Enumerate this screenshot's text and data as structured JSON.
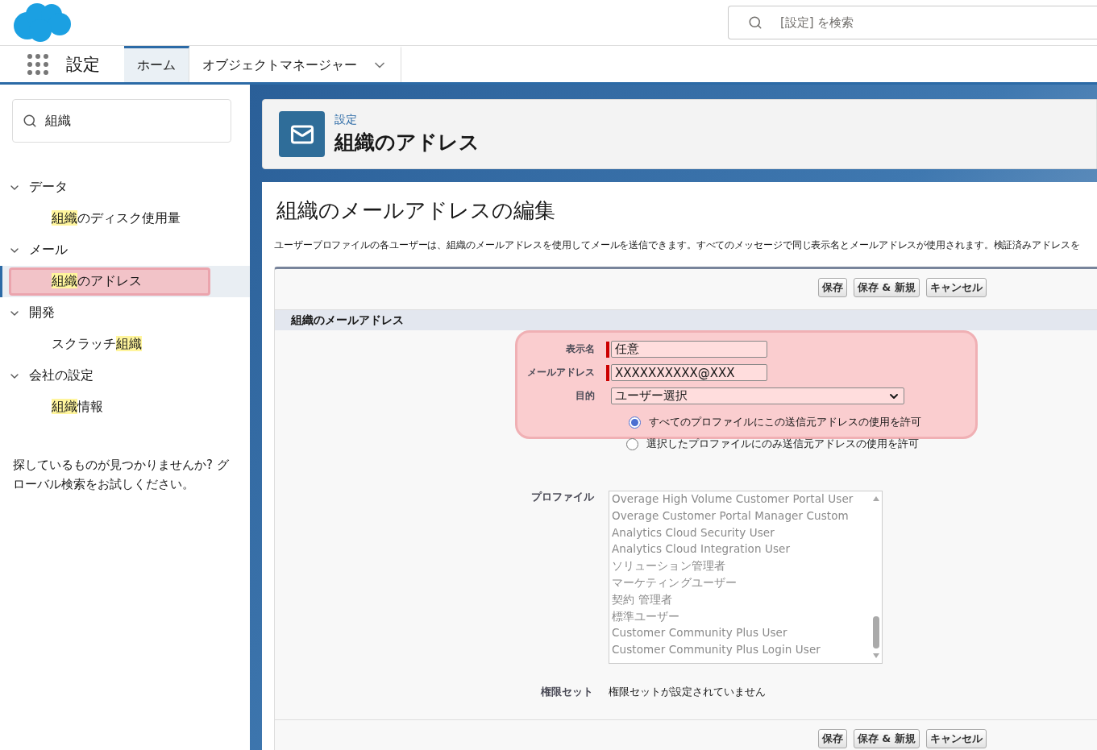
{
  "header": {
    "search": {
      "placeholder": "[設定] を検索"
    }
  },
  "nav": {
    "app_name": "設定",
    "tabs": [
      {
        "label": "ホーム",
        "selected": true,
        "dropdown": false
      },
      {
        "label": "オブジェクトマネージャー",
        "selected": false,
        "dropdown": true
      }
    ]
  },
  "sidebar": {
    "search": {
      "value": "組織"
    },
    "groups": [
      {
        "label": "データ",
        "expanded": true,
        "children": [
          {
            "parts": [
              {
                "text": "組織",
                "match": true
              },
              {
                "text": "のディスク使用量",
                "match": false
              }
            ],
            "selected": false,
            "highlighted": false
          }
        ]
      },
      {
        "label": "メール",
        "expanded": true,
        "children": [
          {
            "parts": [
              {
                "text": "組織",
                "match": true
              },
              {
                "text": "のアドレス",
                "match": false
              }
            ],
            "selected": true,
            "highlighted": true
          }
        ]
      },
      {
        "label": "開発",
        "expanded": true,
        "children": [
          {
            "parts": [
              {
                "text": "スクラッチ",
                "match": false
              },
              {
                "text": "組織",
                "match": true
              }
            ],
            "selected": false,
            "highlighted": false
          }
        ]
      },
      {
        "label": "会社の設定",
        "expanded": true,
        "children": [
          {
            "parts": [
              {
                "text": "組織",
                "match": true
              },
              {
                "text": "情報",
                "match": false
              }
            ],
            "selected": false,
            "highlighted": false
          }
        ]
      }
    ],
    "help_text": "探しているものが見つかりませんか? グローバル検索をお試しください。"
  },
  "page_header": {
    "breadcrumb": "設定",
    "title": "組織のアドレス"
  },
  "content": {
    "title": "組織のメールアドレスの編集",
    "description": "ユーザープロファイルの各ユーザーは、組織のメールアドレスを使用してメールを送信できます。すべてのメッセージで同じ表示名とメールアドレスが使用されます。検証済みアドレスを",
    "buttons": [
      "保存",
      "保存 & 新規",
      "キャンセル"
    ],
    "section_title": "組織のメールアドレス",
    "highlighted": true,
    "fields": [
      {
        "kind": "text",
        "label": "表示名",
        "value": "任意",
        "required": true
      },
      {
        "kind": "text",
        "label": "メールアドレス",
        "value": "XXXXXXXXXX@XXX",
        "required": true
      },
      {
        "kind": "select",
        "label": "目的",
        "value": "ユーザー選択",
        "required": false
      }
    ],
    "radios": [
      {
        "label": "すべてのプロファイルにこの送信元アドレスの使用を許可",
        "selected": true
      },
      {
        "label": "選択したプロファイルにのみ送信元アドレスの使用を許可",
        "selected": false
      }
    ],
    "profiles": {
      "label": "プロファイル",
      "disabled": true,
      "items": [
        "Overage High Volume Customer Portal User",
        "Overage Customer Portal Manager Custom",
        "Analytics Cloud Security User",
        "Analytics Cloud Integration User",
        "ソリューション管理者",
        "マーケティングユーザー",
        "契約 管理者",
        "標準ユーザー",
        "Customer Community Plus User",
        "Customer Community Plus Login User"
      ]
    },
    "permission_sets": {
      "label": "権限セット",
      "value": "権限セットが設定されていません"
    },
    "footer_buttons": [
      "保存",
      "保存 & 新規",
      "キャンセル"
    ]
  }
}
